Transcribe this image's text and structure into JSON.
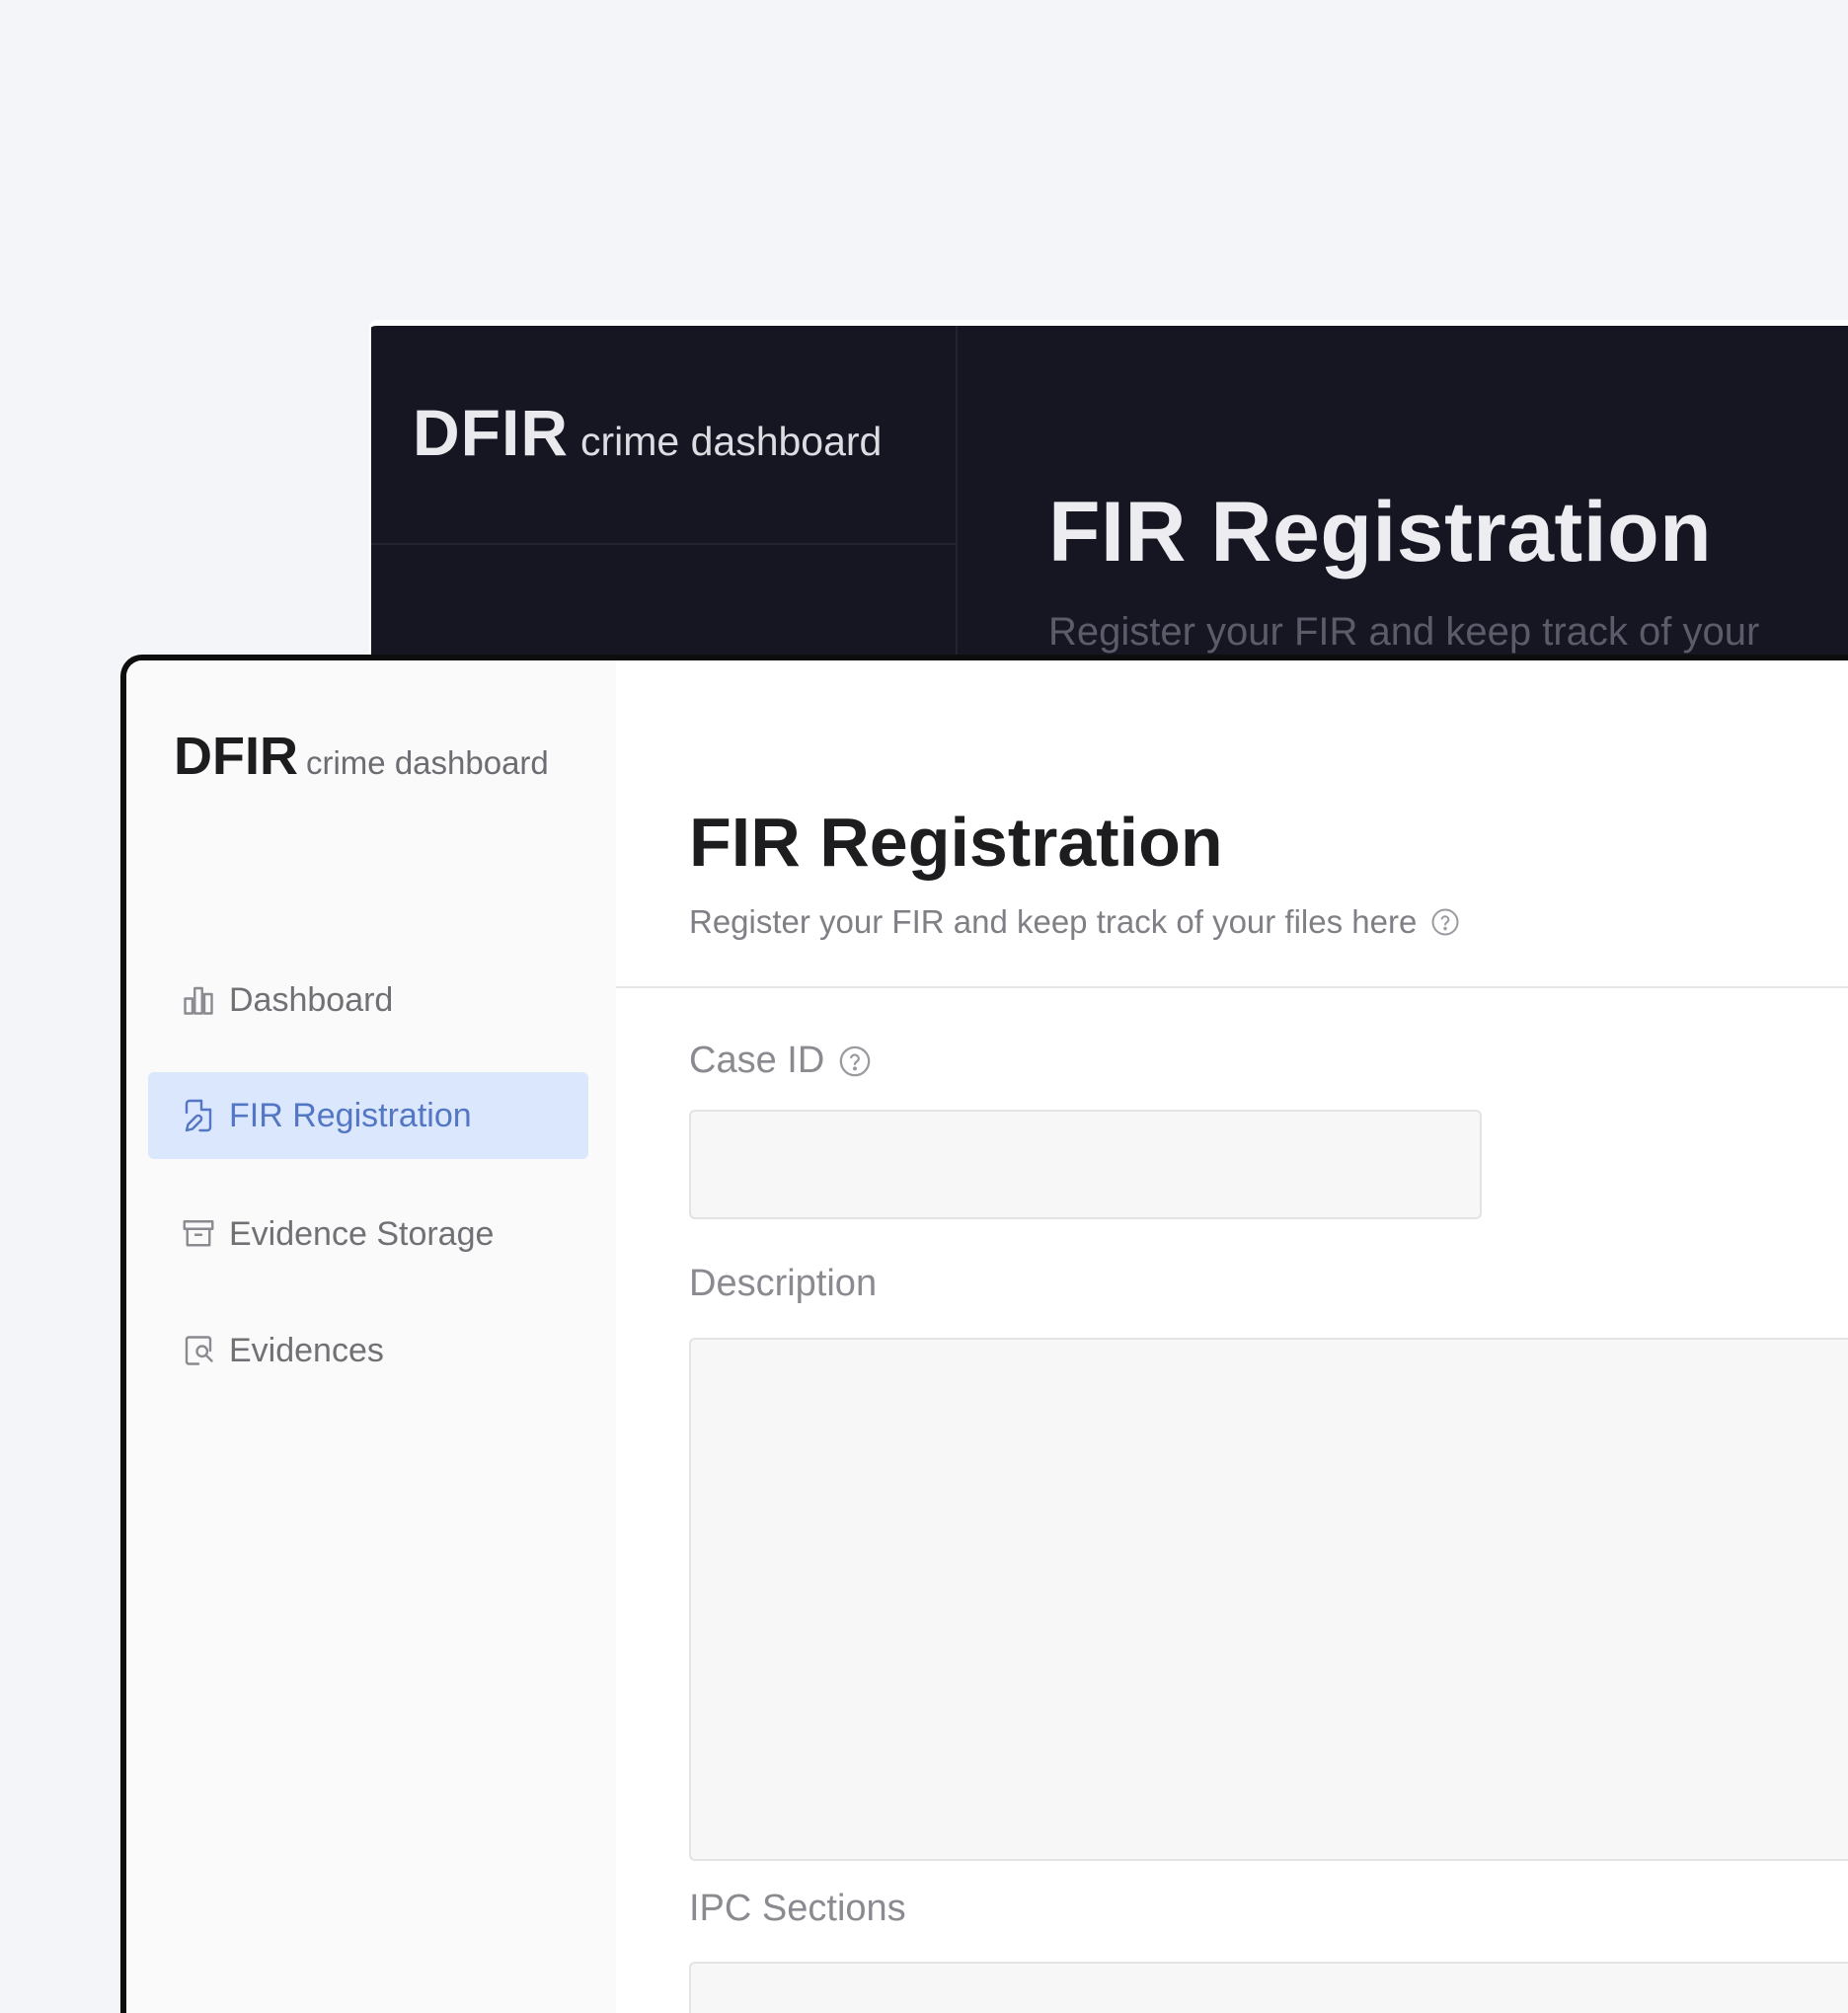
{
  "back_window": {
    "brand_main": "DFIR",
    "brand_sub": "crime dashboard",
    "title": "FIR Registration",
    "subtitle": "Register your FIR and keep track of your"
  },
  "brand": {
    "main": "DFIR",
    "sub": "crime dashboard"
  },
  "sidebar": {
    "items": [
      {
        "label": "Dashboard",
        "icon": "bar-chart-icon",
        "active": false
      },
      {
        "label": "FIR Registration",
        "icon": "file-edit-icon",
        "active": true
      },
      {
        "label": "Evidence Storage",
        "icon": "archive-box-icon",
        "active": false
      },
      {
        "label": "Evidences",
        "icon": "document-search-icon",
        "active": false
      }
    ]
  },
  "header": {
    "title": "FIR Registration",
    "subtitle": "Register your FIR and keep track of your files here"
  },
  "form": {
    "case_id": {
      "label": "Case ID",
      "value": "",
      "placeholder": ""
    },
    "description": {
      "label": "Description",
      "value": "",
      "placeholder": ""
    },
    "ipc_sections": {
      "label": "IPC Sections",
      "value": "",
      "placeholder": ""
    }
  },
  "colors": {
    "accent": "#5377c4",
    "active_bg": "#dbe7fd",
    "dark_bg": "#161622",
    "page_bg": "#f4f5f8"
  }
}
